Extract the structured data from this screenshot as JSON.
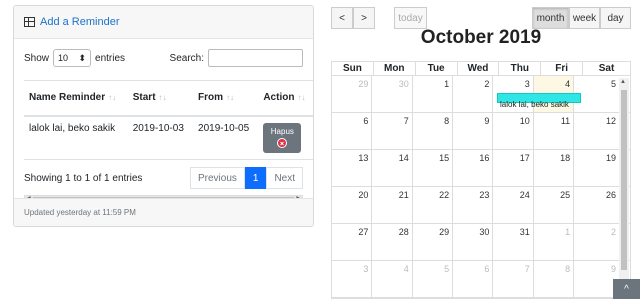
{
  "reminder_card": {
    "header_label": "Add a Reminder",
    "show_label": "Show",
    "entries_value": "10",
    "entries_label": "entries",
    "search_label": "Search:",
    "search_value": "",
    "columns": [
      "Name Reminder",
      "Start",
      "From",
      "Action"
    ],
    "rows": [
      {
        "name": "lalok lai, beko sakik",
        "start": "2019-10-03",
        "from": "2019-10-05",
        "action": "Hapus"
      }
    ],
    "info": "Showing 1 to 1 of 1 entries",
    "pager": {
      "previous": "Previous",
      "current": "1",
      "next": "Next"
    },
    "footer": "Updated yesterday at 11:59 PM"
  },
  "calendar": {
    "prev_icon": "<",
    "next_icon": ">",
    "today_label": "today",
    "views": [
      "month",
      "week",
      "day"
    ],
    "active_view": "month",
    "title": "October 2019",
    "weekdays": [
      "Sun",
      "Mon",
      "Tue",
      "Wed",
      "Thu",
      "Fri",
      "Sat"
    ],
    "weeks": [
      [
        "29",
        "30",
        "1",
        "2",
        "3",
        "4",
        "5"
      ],
      [
        "6",
        "7",
        "8",
        "9",
        "10",
        "11",
        "12"
      ],
      [
        "13",
        "14",
        "15",
        "16",
        "17",
        "18",
        "19"
      ],
      [
        "20",
        "21",
        "22",
        "23",
        "24",
        "25",
        "26"
      ],
      [
        "27",
        "28",
        "29",
        "30",
        "31",
        "1",
        "2"
      ],
      [
        "3",
        "4",
        "5",
        "6",
        "7",
        "8",
        "9"
      ]
    ],
    "event": {
      "title": "lalok lai, beko sakik",
      "color": "#2ee6e6"
    },
    "scroll_top_icon": "^"
  }
}
